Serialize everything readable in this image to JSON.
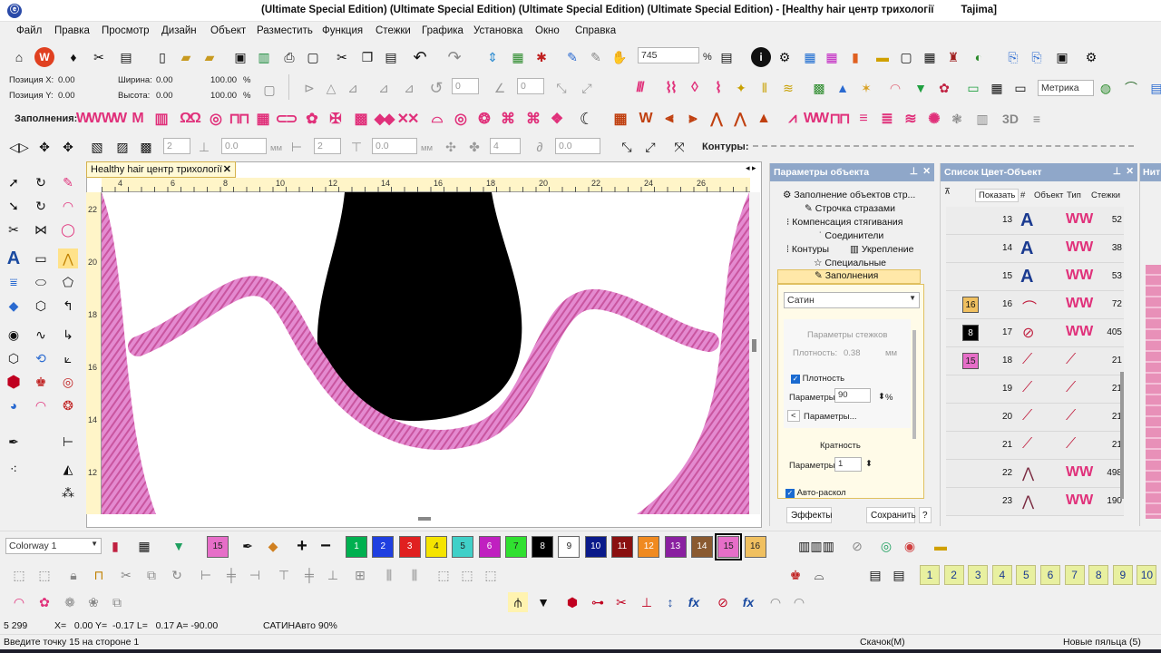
{
  "app": {
    "title": "(Ultimate Special Edition) (Ultimate Special Edition) (Ultimate Special Edition) (Ultimate Special Edition) - [Healthy  hair центр трихології",
    "title_right": "Tajima]"
  },
  "menu": [
    "Файл",
    "Правка",
    "Просмотр",
    "Дизайн",
    "Объект",
    "Разместить",
    "Функция",
    "Стежки",
    "Графика",
    "Установка",
    "Окно",
    "Справка"
  ],
  "toolbar": {
    "zoom_value": "745",
    "zoom_unit": "%",
    "units_select": "Метрика"
  },
  "position": {
    "x_label": "Позиция X:",
    "x_value": "0.00",
    "y_label": "Позиция Y:",
    "y_value": "0.00",
    "w_label": "Ширина:",
    "w_value": "0.00",
    "w_pct": "100.00",
    "h_label": "Высота:",
    "h_value": "0.00",
    "h_pct": "100.00",
    "unit": "%"
  },
  "fills": {
    "label": "Заполнения:"
  },
  "contours": {
    "label": "Контуры:"
  },
  "transform": {
    "f1": "2",
    "f2": "0.0",
    "f3": "2",
    "f4": "0.0",
    "f5": "4",
    "f6": "0.0",
    "mm": "мм"
  },
  "rotate": {
    "v1": "0",
    "v2": "0"
  },
  "document": {
    "tab_title": "Healthy  hair центр трихології",
    "ruler_h": [
      "4",
      "6",
      "8",
      "10",
      "12",
      "14",
      "16",
      "18",
      "20",
      "22",
      "24",
      "26"
    ],
    "ruler_v": [
      "22",
      "20",
      "18",
      "16",
      "14",
      "12"
    ]
  },
  "props_panel": {
    "title": "Параметры объекта",
    "tree": [
      "Заполнение объектов стр...",
      "Строчка стразами",
      "Компенсация стягивания",
      "Соединители",
      "Контуры",
      "Укрепление",
      "Специальные",
      "Заполнения"
    ],
    "fill_type": "Сатин",
    "stitch_params": "Параметры стежков",
    "density_label": "Плотность:",
    "density_value": "0.38",
    "density_unit": "мм",
    "density_check": "Плотность",
    "params_label": "Параметры:",
    "params_value": "90",
    "params_unit": "%",
    "params_button": "Параметры...",
    "multiplicity": "Кратность",
    "mult_label": "Параметры:",
    "mult_value": "1",
    "auto_label": "Авто-раскол",
    "effects_button": "Эффекты",
    "save_button": "Сохранить",
    "help_button": "?"
  },
  "color_panel": {
    "title": "Список Цвет-Объект",
    "show_button": "Показать",
    "headers": [
      "#",
      "Объект",
      "Тип",
      "Стежки"
    ],
    "rows": [
      {
        "num": "13",
        "stitches": "52",
        "obj": "A",
        "swatch": ""
      },
      {
        "num": "14",
        "stitches": "38",
        "obj": "A",
        "swatch": ""
      },
      {
        "num": "15",
        "stitches": "53",
        "obj": "A",
        "swatch": ""
      },
      {
        "num": "16",
        "stitches": "72",
        "obj": "curve",
        "swatch": "16"
      },
      {
        "num": "17",
        "stitches": "405",
        "obj": "curve",
        "swatch": "8"
      },
      {
        "num": "18",
        "stitches": "21",
        "obj": "line",
        "swatch": "15"
      },
      {
        "num": "19",
        "stitches": "21",
        "obj": "line",
        "swatch": ""
      },
      {
        "num": "20",
        "stitches": "21",
        "obj": "line",
        "swatch": ""
      },
      {
        "num": "21",
        "stitches": "21",
        "obj": "line",
        "swatch": ""
      },
      {
        "num": "22",
        "stitches": "498",
        "obj": "node",
        "swatch": ""
      },
      {
        "num": "23",
        "stitches": "190",
        "obj": "node",
        "swatch": ""
      }
    ]
  },
  "right_panel_title": "Нит",
  "colorway": {
    "name": "Colorway 1",
    "current": "15",
    "chips": [
      {
        "n": "1",
        "c": "#00b050",
        "t": "#fff"
      },
      {
        "n": "2",
        "c": "#1f3fe0",
        "t": "#fff"
      },
      {
        "n": "3",
        "c": "#e02020",
        "t": "#fff"
      },
      {
        "n": "4",
        "c": "#f5e400",
        "t": "#222"
      },
      {
        "n": "5",
        "c": "#40d0c8",
        "t": "#222"
      },
      {
        "n": "6",
        "c": "#c020c0",
        "t": "#fff"
      },
      {
        "n": "7",
        "c": "#30e030",
        "t": "#222"
      },
      {
        "n": "8",
        "c": "#000000",
        "t": "#fff"
      },
      {
        "n": "9",
        "c": "#ffffff",
        "t": "#222"
      },
      {
        "n": "10",
        "c": "#0a1a8a",
        "t": "#fff"
      },
      {
        "n": "11",
        "c": "#8a1010",
        "t": "#fff"
      },
      {
        "n": "12",
        "c": "#f08a20",
        "t": "#fff"
      },
      {
        "n": "13",
        "c": "#8a20a0",
        "t": "#fff"
      },
      {
        "n": "14",
        "c": "#8a5a30",
        "t": "#fff"
      },
      {
        "n": "15",
        "c": "#e66ec8",
        "t": "#222"
      },
      {
        "n": "16",
        "c": "#f0c060",
        "t": "#222"
      }
    ]
  },
  "hoop_numbers": [
    "1",
    "2",
    "3",
    "4",
    "5",
    "6",
    "7",
    "8",
    "9",
    "10"
  ],
  "status": {
    "count": "5 299",
    "coords": "X=   0.00 Y=  -0.17 L=   0.17 A= -90.00",
    "mode": "САТИНАвто 90%",
    "hint": "Введите точку 15 на стороне 1",
    "download": "Скачок(М)",
    "hoop": "Новые пяльца (5)"
  },
  "colors": {
    "pink": "#e06cc0",
    "accent": "#e0307a"
  }
}
